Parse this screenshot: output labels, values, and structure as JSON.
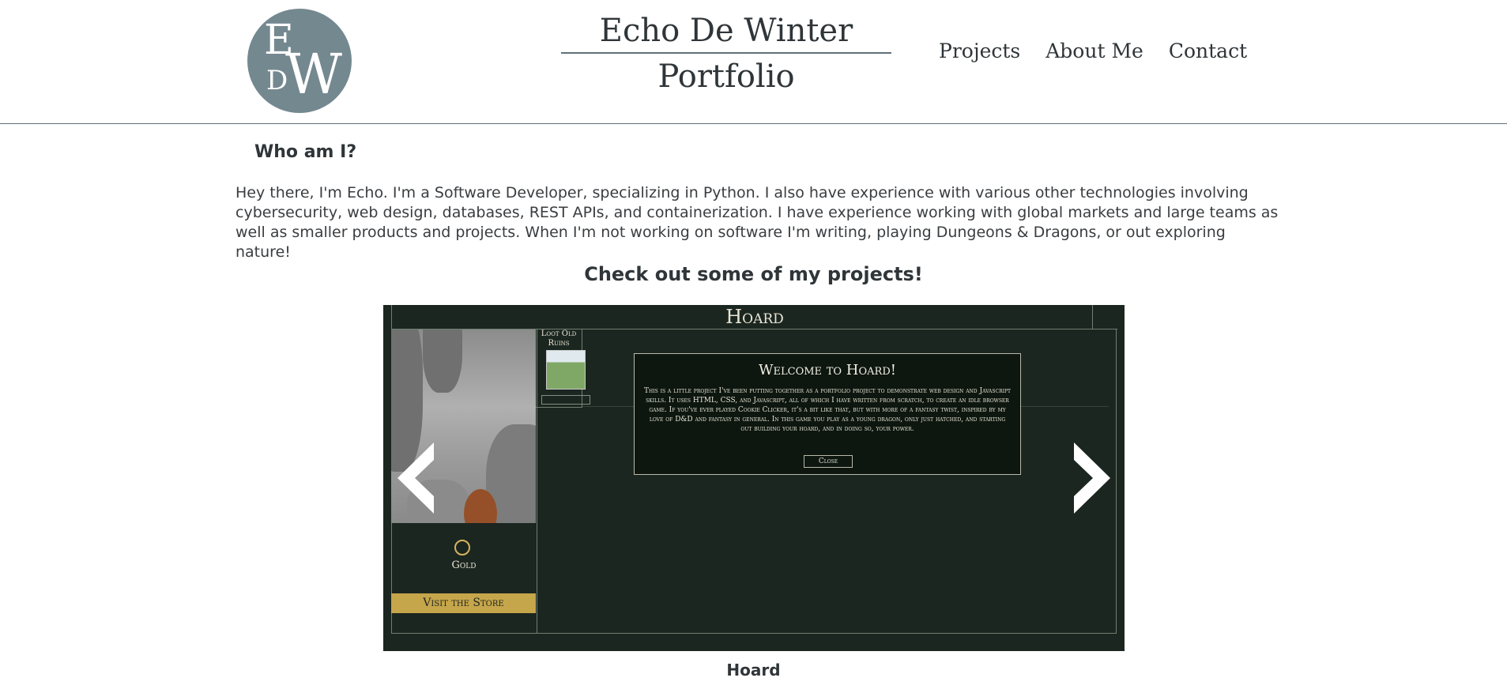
{
  "header": {
    "logo_letters": [
      "E",
      "D",
      "W"
    ],
    "site_title": "Echo De Winter",
    "site_subtitle": "Portfolio",
    "nav": [
      {
        "label": "Projects"
      },
      {
        "label": "About Me"
      },
      {
        "label": "Contact"
      }
    ]
  },
  "about": {
    "heading": "Who am I?",
    "bio": "Hey there, I'm Echo. I'm a Software Developer, specializing in Python. I also have experience with various other technologies involving cybersecurity, web design, databases, REST APIs, and containerization. I have experience working with global markets and large teams as well as smaller products and projects. When I'm not working on software I'm writing, playing Dungeons & Dragons, or out exploring nature!"
  },
  "projects": {
    "heading": "Check out some of my projects!",
    "carousel": {
      "current_caption": "Hoard",
      "screenshot": {
        "game_title": "Hoard",
        "resource_label": "Gold",
        "store_button": "Visit the Store",
        "loot_label": "Loot Old Ruins",
        "modal_title": "Welcome to Hoard!",
        "modal_text": "This is a little project I've been putting together as a portfolio project to demonstrate web design and Javascript skills. It uses HTML, CSS, and Javascript, all of which I have written from scratch, to create an idle browser game. If you've ever played Cookie Clicker, it's a bit like that, but with more of a fantasy twist, inspired by my love of D&D and fantasy in general. In this game you play as a young dragon, only just hatched, and starting out building your hoard, and in doing so, your power.",
        "modal_close": "Close"
      },
      "prev_icon": "chevron-left-icon",
      "next_icon": "chevron-right-icon"
    }
  },
  "colors": {
    "accent": "#748890",
    "text": "#3a3d40",
    "game_bg": "#1c2620",
    "store_button": "#c6a64b"
  }
}
